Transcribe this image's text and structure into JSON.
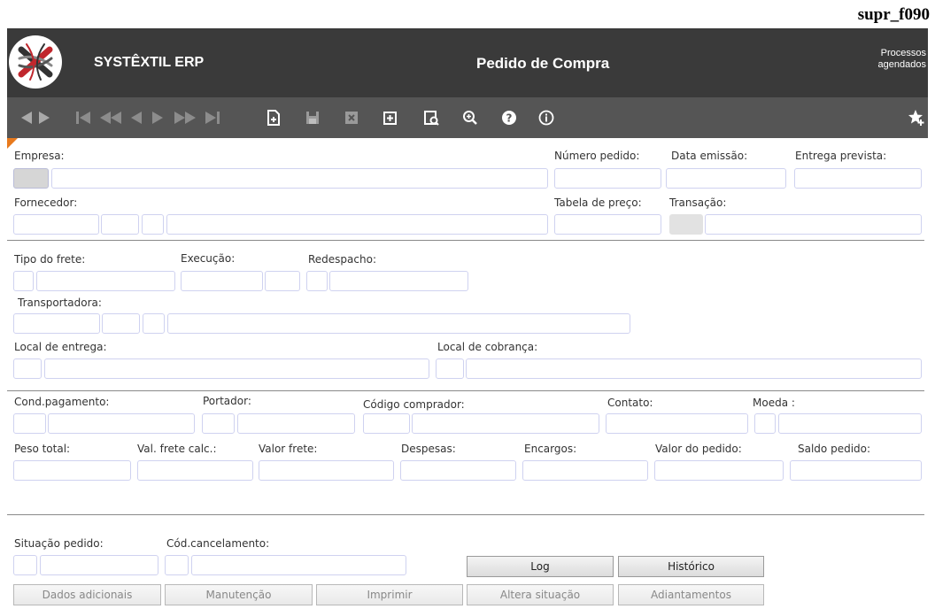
{
  "form_code": "supr_f090",
  "header": {
    "app_title": "SYSTÊXTIL ERP",
    "page_title": "Pedido de Compra",
    "scheduled_line1": "Processos",
    "scheduled_line2": "agendados"
  },
  "toolbar": {
    "icons": [
      "back-icon",
      "forward-icon",
      "first-record-icon",
      "previous-page-icon",
      "previous-record-icon",
      "next-record-icon",
      "next-page-icon",
      "last-record-icon",
      "new-record-icon",
      "save-icon",
      "delete-icon",
      "add-icon",
      "search-icon",
      "zoom-icon",
      "help-icon",
      "info-icon",
      "favorite-icon"
    ],
    "accent_color": "#e87a1d"
  },
  "labels": {
    "empresa": "Empresa:",
    "numero_pedido": "Número pedido:",
    "data_emissao": "Data emissão:",
    "entrega_prevista": "Entrega prevista:",
    "fornecedor": "Fornecedor:",
    "tabela_preco": "Tabela de preço:",
    "transacao": "Transação:",
    "tipo_frete": "Tipo do frete:",
    "execucao": "Execução:",
    "redespacho": "Redespacho:",
    "transportadora": "Transportadora:",
    "local_entrega": "Local de entrega:",
    "local_cobranca": "Local de cobrança:",
    "cond_pagamento": "Cond.pagamento:",
    "portador": "Portador:",
    "codigo_comprador": "Código comprador:",
    "contato": "Contato:",
    "moeda": "Moeda :",
    "peso_total": "Peso total:",
    "val_frete_calc": "Val. frete calc.:",
    "valor_frete": "Valor frete:",
    "despesas": "Despesas:",
    "encargos": "Encargos:",
    "valor_pedido": "Valor do pedido:",
    "saldo_pedido": "Saldo pedido:",
    "situacao_pedido": "Situação pedido:",
    "cod_cancelamento": "Cód.cancelamento:"
  },
  "buttons": {
    "log": "Log",
    "historico": "Histórico",
    "dados_adicionais": "Dados adicionais",
    "manutencao": "Manutenção",
    "imprimir": "Imprimir",
    "altera_situacao": "Altera situação",
    "adiantamentos": "Adiantamentos"
  }
}
